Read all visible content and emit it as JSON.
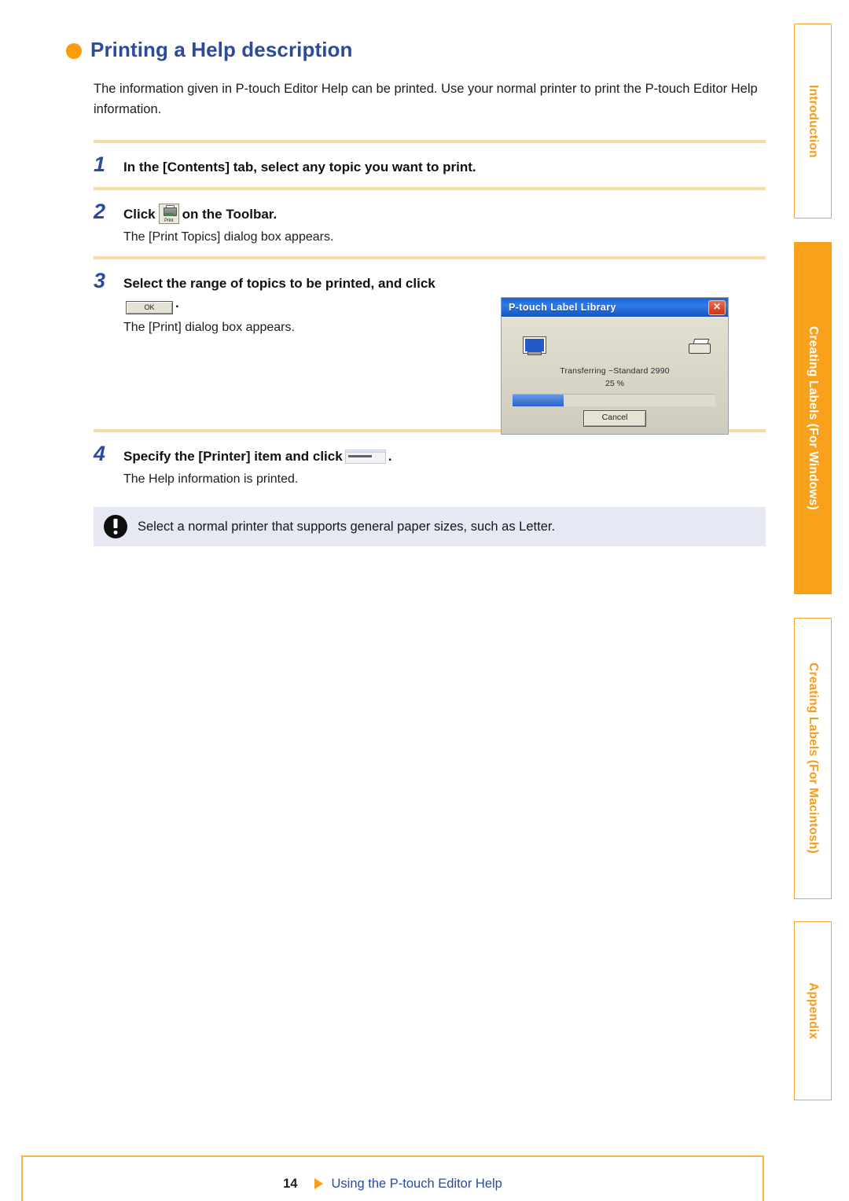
{
  "heading": {
    "title": "Printing a Help description",
    "bullet_color": "#F99D0C",
    "text_color": "#2B4AA0"
  },
  "intro": "The information given in P-touch Editor Help can be printed. Use your normal printer to print the P-touch Editor Help information.",
  "steps": [
    {
      "number": "1",
      "title_before": "In the [Contents] tab, select any topic you want to print.",
      "title_after": "",
      "widget": "none",
      "sub": ""
    },
    {
      "number": "2",
      "title_before": "Click",
      "title_after": "on the Toolbar.",
      "widget": "print-toolbar-button",
      "widget_label": "Print",
      "sub": "The [Print Topics] dialog box appears."
    },
    {
      "number": "3",
      "title_before": "Select the range of topics to be printed, and click",
      "title_after": ".",
      "widget": "ok-button",
      "widget_label": "OK",
      "sub": "The [Print] dialog box appears."
    },
    {
      "number": "4",
      "title_before": "Specify the [Printer] item and click",
      "title_after": ".",
      "widget": "blurred-button",
      "widget_label": "",
      "sub": "The Help information is printed."
    }
  ],
  "dialog_screenshot": {
    "title": "P-touch Label Library",
    "close_glyph": "✕",
    "status": "Transferring ~Standard 2990",
    "percent": "25 %",
    "progress_value": 25,
    "cancel_label": "Cancel",
    "source_icon": "monitor-icon",
    "target_icon": "printer-icon"
  },
  "note": {
    "icon": "exclamation-icon",
    "text": "Select a normal printer that supports general paper sizes, such as Letter."
  },
  "side_tabs": [
    {
      "id": "introduction",
      "label": "Introduction",
      "active": false
    },
    {
      "id": "windows",
      "label": "Creating Labels (For Windows)",
      "active": true
    },
    {
      "id": "macintosh",
      "label": "Creating Labels (For Macintosh)",
      "active": false
    },
    {
      "id": "appendix",
      "label": "Appendix",
      "active": false
    }
  ],
  "footer": {
    "page_number": "14",
    "link_text": "Using the P-touch Editor Help",
    "arrow_color": "#F79E1B"
  }
}
